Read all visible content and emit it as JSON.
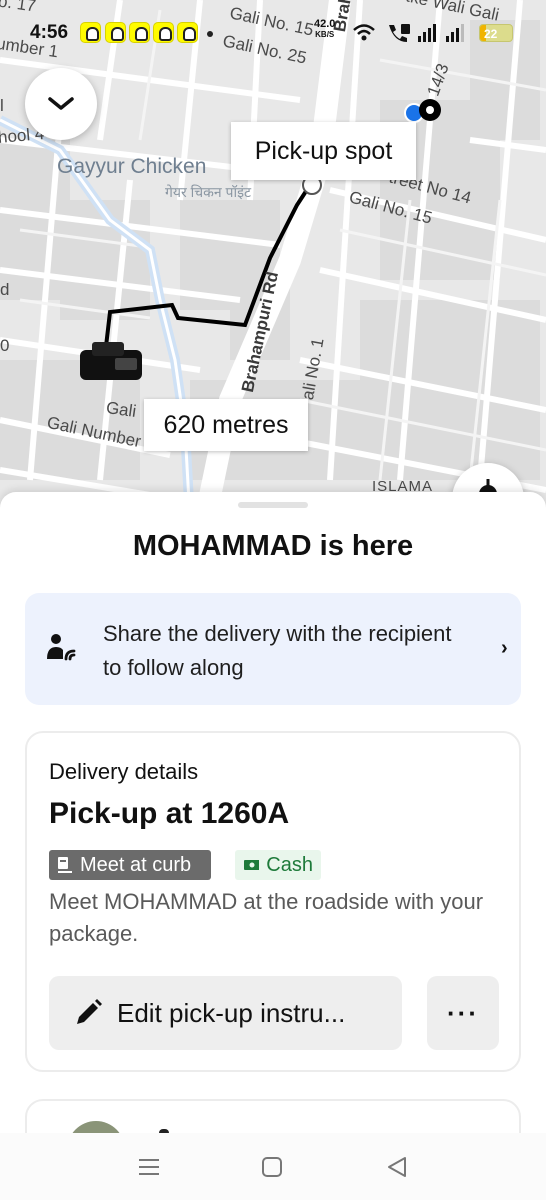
{
  "status_bar": {
    "time": "4:56",
    "net_speed": "42.0",
    "net_speed_unit": "KB/S",
    "battery_level": "22",
    "icons": [
      "snapchat-icon",
      "snapchat-icon",
      "snapchat-icon",
      "snapchat-icon",
      "snapchat-icon",
      "wifi-icon",
      "volte-call-icon",
      "signal-icon",
      "signal-icon",
      "battery-icon"
    ]
  },
  "map": {
    "street_labels": {
      "gali_17": "o. 17",
      "number_top": "umber 1",
      "gali_15_top": "Gali No. 15",
      "gali_25": "Gali No. 25",
      "brahampu_top": "Brahampu",
      "tke_wali_gali": "tke Wali Gali",
      "lane_14_3": "14/3",
      "hool": "hool 4",
      "street_no_14": "treet No 14",
      "gali_15": "Gali No. 15",
      "brahampuri_rd": "Brahampuri Rd",
      "ali_no_1": "ali No. 1",
      "gali_left": "Gali",
      "gali_number_7": "Gali Number 7",
      "islam": "ISLAMA",
      "edge_l": "l",
      "edge_d": "d",
      "edge_0": "0"
    },
    "poi": {
      "name": "Gayyur Chicken",
      "name_hindi": "गेयर चिकन पॉइंट"
    },
    "pickup_callout": "Pick-up spot",
    "distance_callout": "620 metres",
    "route_color": "#000000",
    "user_location_color": "#1a73e8"
  },
  "sheet": {
    "title": "MOHAMMAD is here",
    "share": {
      "text": "Share the delivery with the recipient to follow along",
      "chevron": "›"
    },
    "details": {
      "heading": "Delivery details",
      "title": "Pick-up at 1260A",
      "chip_meet": "Meet at curb",
      "chip_cash": "Cash",
      "description": "Meet MOHAMMAD at the roadside with your package.",
      "edit_button": "Edit pick-up instru...",
      "more_button": "···"
    }
  },
  "nav": {
    "recent": "recent-apps-icon",
    "home": "home-icon",
    "back": "back-icon"
  }
}
